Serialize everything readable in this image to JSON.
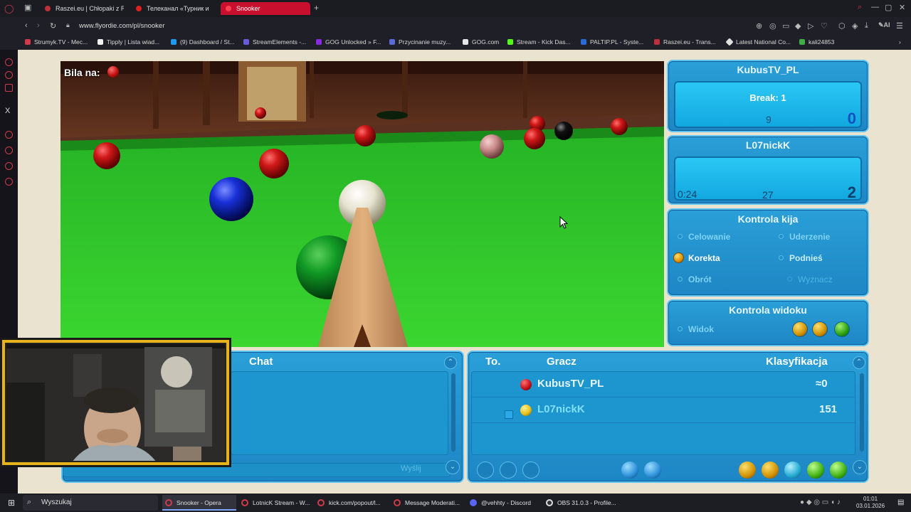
{
  "browser": {
    "tabs": [
      {
        "label": "Raszei.eu | Chłopaki z Ras"
      },
      {
        "label": "Телеканал «Турник и"
      },
      {
        "label": "Snooker"
      }
    ],
    "url": "www.flyordie.com/pl/snooker",
    "bookmarks": [
      {
        "label": "Strumyk.TV - Mec..."
      },
      {
        "label": "Tipply | Lista wiad..."
      },
      {
        "label": "(9) Dashboard / St..."
      },
      {
        "label": "StreamElements -..."
      },
      {
        "label": "GOG Unlocked » F..."
      },
      {
        "label": "Przycinanie muzy..."
      },
      {
        "label": "GOG.com"
      },
      {
        "label": "Stream - Kick Das..."
      },
      {
        "label": "PALTIP.PL - Syste..."
      },
      {
        "label": "Raszei.eu - Trans..."
      },
      {
        "label": "Latest National Co..."
      },
      {
        "label": "kali24853"
      }
    ],
    "ai_label": "AI"
  },
  "game": {
    "ball_on_label": "Bila na:",
    "player1": {
      "name": "KubusTV_PL",
      "break_label": "Break: 1",
      "points_left": "9",
      "score": "0"
    },
    "player2": {
      "name": "L07nickK",
      "timer": "0:24",
      "points_left": "27",
      "score": "2"
    },
    "cue_control": {
      "title": "Kontrola kija",
      "options": [
        "Celowanie",
        "Uderzenie",
        "Korekta",
        "Podnieś",
        "Obrót",
        "Wyznacz"
      ]
    },
    "view_control": {
      "title": "Kontrola widoku",
      "option": "Widok"
    },
    "chat": {
      "title": "Chat",
      "send_label": "Wyślij"
    },
    "ranking": {
      "col_turn": "To.",
      "col_player": "Gracz",
      "col_rank": "Klasyfikacja",
      "rows": [
        {
          "name": "KubusTV_PL",
          "rating": "≈0",
          "ball_color": "#c8141c"
        },
        {
          "name": "L07nickK",
          "rating": "151",
          "ball_color": "#e8c21a"
        }
      ]
    }
  },
  "taskbar": {
    "search_label": "Wyszukaj",
    "items": [
      {
        "label": "Snooker - Opera"
      },
      {
        "label": "LotnicK Stream - W..."
      },
      {
        "label": "kick.com/popout/l..."
      },
      {
        "label": "Message Moderati..."
      },
      {
        "label": "@vehhty - Discord"
      },
      {
        "label": "OBS 31.0.3 - Profile..."
      }
    ],
    "time": "01:01",
    "date": "03.01.2026"
  },
  "colors": {
    "felt": "#2fc52a",
    "panel": "#1e8fc9",
    "panel_inner": "#18b4ea",
    "accent_red": "#d0202e"
  }
}
